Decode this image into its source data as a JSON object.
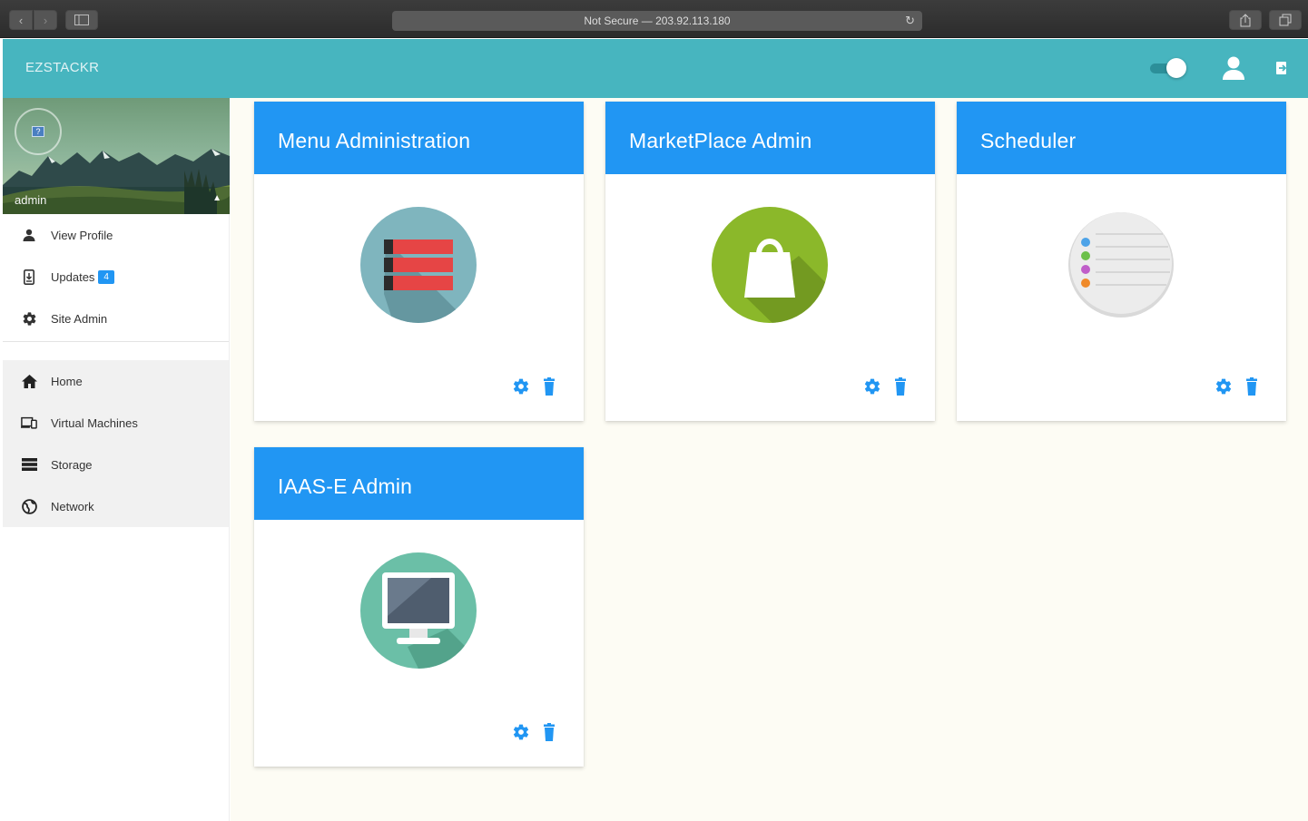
{
  "browser": {
    "address": "Not Secure — 203.92.113.180"
  },
  "header": {
    "brand": "EZSTACKR"
  },
  "sidebar": {
    "user": "admin",
    "profile_menu": [
      {
        "label": "View Profile",
        "icon": "user-icon"
      },
      {
        "label": "Updates",
        "icon": "download-device-icon",
        "badge": "4"
      },
      {
        "label": "Site Admin",
        "icon": "gear-icon"
      }
    ],
    "nav": [
      {
        "label": "Home",
        "icon": "home-icon"
      },
      {
        "label": "Virtual Machines",
        "icon": "devices-icon"
      },
      {
        "label": "Storage",
        "icon": "storage-icon"
      },
      {
        "label": "Network",
        "icon": "globe-icon"
      }
    ]
  },
  "cards": [
    {
      "title": "Menu Administration",
      "icon": "menu-list-icon"
    },
    {
      "title": "MarketPlace Admin",
      "icon": "shopping-bag-icon"
    },
    {
      "title": "Scheduler",
      "icon": "checklist-icon"
    },
    {
      "title": "IAAS-E Admin",
      "icon": "monitor-icon"
    }
  ],
  "colors": {
    "header": "#47b5bf",
    "card_header": "#2196f3",
    "action": "#2196f3",
    "badge": "#2196f3"
  }
}
